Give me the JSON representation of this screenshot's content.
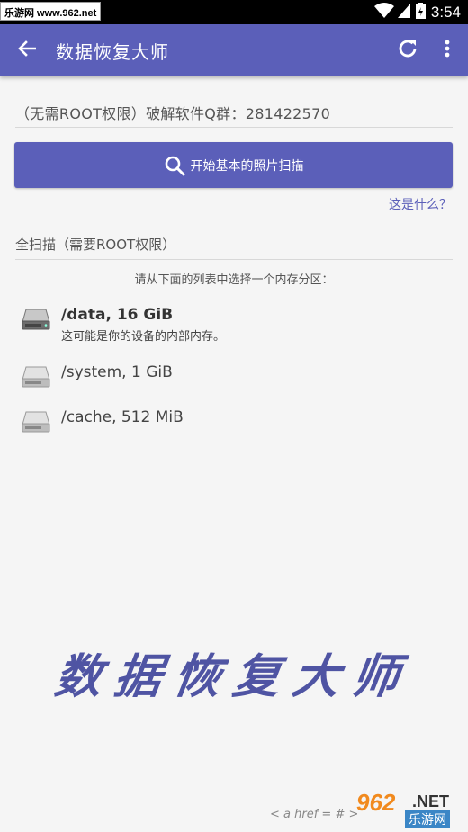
{
  "status_bar": {
    "badge": "乐游网 www.962.net",
    "time": "3:54"
  },
  "app_bar": {
    "title": "数据恢复大师"
  },
  "note": "（无需ROOT权限）破解软件Q群：281422570",
  "scan_button": {
    "label": "开始基本的照片扫描"
  },
  "whats_this": "这是什么？",
  "full_scan": "全扫描（需要ROOT权限）",
  "select_hint": "请从下面的列表中选择一个内存分区：",
  "partitions": [
    {
      "name": "/data, 16 GiB",
      "desc": "这可能是你的设备的内部内存。"
    },
    {
      "name": "/system, 1 GiB"
    },
    {
      "name": "/cache, 512 MiB"
    }
  ],
  "watermark_title": "数据恢复大师",
  "footer_code": "< a href = # >",
  "watermark_logo": {
    "num": "962",
    "net": ".NET",
    "cn": "乐游网"
  },
  "colors": {
    "primary": "#5b5fb9",
    "background": "#f5f5f5"
  },
  "icons": [
    "arrow-back-icon",
    "refresh-icon",
    "more-vert-icon",
    "search-icon",
    "hard-disk-icon",
    "wifi-icon",
    "signal-icon",
    "battery-icon"
  ]
}
